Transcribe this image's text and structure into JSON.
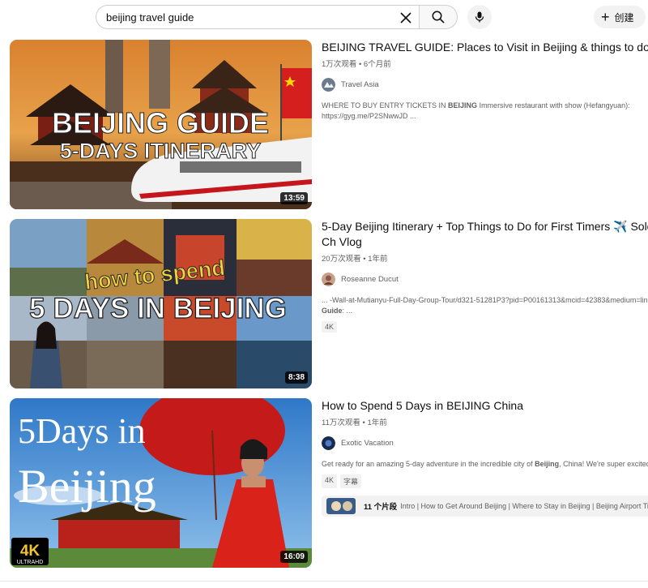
{
  "search": {
    "query": "beijing travel guide"
  },
  "header": {
    "create_label": "创建"
  },
  "icons": {
    "clear": "close-icon",
    "search": "search-icon",
    "mic": "mic-icon",
    "create": "plus-icon"
  },
  "colors": {
    "accent_red": "#c4161c",
    "meta_gray": "#606060",
    "chip_bg": "#f2f2f2"
  },
  "results": [
    {
      "title": "BEIJING TRAVEL GUIDE: Places to Visit in Beijing & things to do in C",
      "views": "1万次观看",
      "age": "6个月前",
      "channel": "Travel Asia",
      "desc_pre": "WHERE TO BUY ENTRY TICKETS IN ",
      "desc_bold": "BEIJING",
      "desc_post": " Immersive restaurant with show (Hefangyuan):",
      "desc_line2": "https://gyg.me/P2SNwwJD ...",
      "duration": "13:59",
      "thumb_text1": "BEIJING GUIDE",
      "thumb_text2": "5-DAYS ITINERARY"
    },
    {
      "title": "5-Day Beijing Itinerary + Top Things to Do for First Timers ✈️ Solo Ch Vlog",
      "views": "20万次观看",
      "age": "1年前",
      "channel": "Roseanne Ducut",
      "desc_line1": "... -Wall-at-Mutianyu-Full-Day-Group-Tour/d321-51281P3?pid=P00161313&mcid=42383&medium=link",
      "desc_bold": "Guide",
      "desc_post": ": ...",
      "badge": "4K",
      "duration": "8:38",
      "thumb_text1": "how to spend",
      "thumb_text2": "5 DAYS IN BEIJING"
    },
    {
      "title": "How to Spend 5 Days in BEIJING China",
      "views": "11万次观看",
      "age": "1年前",
      "channel": "Exotic Vacation",
      "desc_pre": "Get ready for an amazing 5-day adventure in the incredible city of ",
      "desc_bold": "Beijing",
      "desc_post": ", China! We're super excited to",
      "badges": [
        "4K",
        "字幕"
      ],
      "chapters_count": "11 个片段",
      "chapters_list": "Intro | How to Get Around Beijing | Where to Stay in Beijing | Beijing Airport Tip",
      "duration": "16:09",
      "thumb_text1": "5Days in",
      "thumb_text2": "Beijing",
      "thumb_badge_4k": "4K",
      "thumb_badge_uhd": "ULTRAHD"
    }
  ]
}
